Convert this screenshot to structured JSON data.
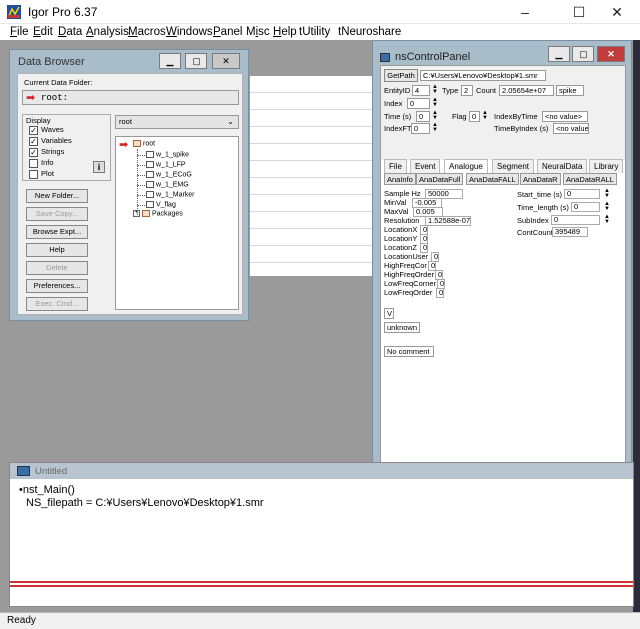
{
  "app": {
    "title": "Igor Pro 6.37",
    "minimize": "–",
    "maximize": "☐",
    "close": "✕"
  },
  "menu": [
    {
      "key": "F",
      "rest": "ile"
    },
    {
      "key": "E",
      "rest": "dit"
    },
    {
      "key": "D",
      "rest": "ata"
    },
    {
      "key": "A",
      "rest": "nalysis"
    },
    {
      "key": "M",
      "rest": "acros"
    },
    {
      "key": "W",
      "rest": "indows"
    },
    {
      "key": "P",
      "rest": "anel"
    },
    {
      "key": "M",
      "pre": "",
      "rest": "isc",
      "label": "Misc"
    },
    {
      "key": "H",
      "rest": "elp"
    },
    {
      "key": "",
      "rest": "tUtility"
    },
    {
      "key": "",
      "rest": "tNeuroshare"
    }
  ],
  "data_browser": {
    "title": "Data Browser",
    "current_folder_label": "Current Data Folder:",
    "current_folder": "root:",
    "display_label": "Display",
    "display_options": [
      {
        "label": "Waves",
        "checked": true
      },
      {
        "label": "Variables",
        "checked": true
      },
      {
        "label": "Strings",
        "checked": true
      },
      {
        "label": "Info",
        "checked": false
      },
      {
        "label": "Plot",
        "checked": false
      }
    ],
    "buttons": [
      {
        "label": "New Folder...",
        "enabled": true
      },
      {
        "label": "Save Copy...",
        "enabled": false
      },
      {
        "label": "Browse Expt...",
        "enabled": true
      },
      {
        "label": "Help",
        "enabled": true
      },
      {
        "label": "Delete",
        "enabled": false
      },
      {
        "label": "Preferences...",
        "enabled": true
      },
      {
        "label": "Exec. Cmd...",
        "enabled": false
      }
    ],
    "folder_select": "root",
    "tree": {
      "root": "root",
      "waves": [
        "w_1_spike",
        "w_1_LFP",
        "w_1_ECoG",
        "w_1_EMG",
        "w_1_Marker",
        "V_flag"
      ],
      "packages": "Packages"
    }
  },
  "ns_panel": {
    "title": "nsControlPanel",
    "getpath_label": "GetPath",
    "path_value": "C:¥Users¥Lenovo¥Desktop¥1.smr",
    "entity_label": "EntityID",
    "entity_value": "4",
    "type_label": "Type",
    "type_value": "2",
    "count_label": "Count",
    "count_value": "2.05654e+07",
    "kind_value": "spike",
    "index_label": "Index",
    "index_value": "0",
    "time_label": "Time (s)",
    "time_value": "0",
    "flag_label": "Flag",
    "flag_value": "0",
    "index_by_time_label": "IndexByTime",
    "index_by_time_value": "<no value>",
    "index_ft_label": "IndexFT",
    "index_ft_value": "0",
    "time_by_index_label": "TimeByIndex (s)",
    "time_by_index_value": "<no value",
    "tabs": [
      "File",
      "Event",
      "Analogue",
      "Segment",
      "NeuralData",
      "Library"
    ],
    "active_tab": "Analogue",
    "subtabs": [
      "AnaInfo",
      "AnaDataFull",
      "AnaDataFALL",
      "AnaDataR",
      "AnaDataRALL"
    ],
    "analogue_left": [
      {
        "label": "Sample Hz",
        "value": "50000"
      },
      {
        "label": "MinVal",
        "value": "-0.005"
      },
      {
        "label": "MaxVal",
        "value": "0.005"
      },
      {
        "label": "Resolution",
        "value": "1.52588e-07"
      },
      {
        "label": "LocationX",
        "value": "0"
      },
      {
        "label": "LocationY",
        "value": "0"
      },
      {
        "label": "LocationZ",
        "value": "0"
      },
      {
        "label": "LocationUser",
        "value": "0"
      },
      {
        "label": "HighFreqCor",
        "value": "0"
      },
      {
        "label": "HighFreqOrder",
        "value": "0"
      },
      {
        "label": "LowFreqCorner",
        "value": "0"
      },
      {
        "label": "LowFreqOrder",
        "value": "0"
      }
    ],
    "analogue_right": [
      {
        "label": "Start_time (s)",
        "value": "0"
      },
      {
        "label": "Time_length (s)",
        "value": "0"
      },
      {
        "label": "SubIndex",
        "value": "0"
      },
      {
        "label": "ContCount",
        "value": "395489"
      }
    ],
    "units_value": "V",
    "probe_value": "unknown",
    "comment_value": "No comment"
  },
  "command_window": {
    "title": "Untitled",
    "line1": "•nst_Main()",
    "line2": "NS_filepath = C:¥Users¥Lenovo¥Desktop¥1.smr"
  },
  "status": "Ready"
}
